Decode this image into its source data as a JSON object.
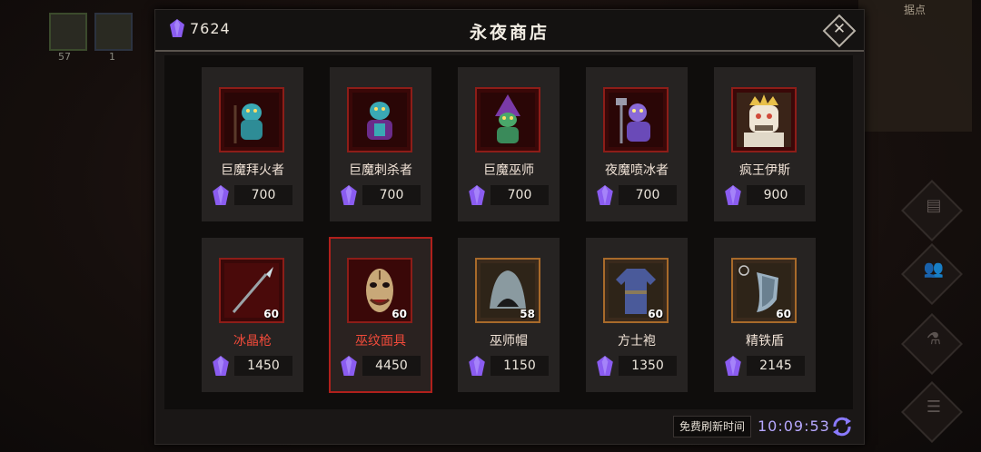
{
  "background": {
    "left_slots": [
      {
        "count": "57"
      },
      {
        "count": "1"
      }
    ],
    "minimap_title": "据点"
  },
  "shop": {
    "title": "永夜商店",
    "currency_total": "7624",
    "close_label": "✕",
    "refresh": {
      "label": "免费刷新时间",
      "time": "10:09:53"
    },
    "colors": {
      "gem": "#8a5cf0",
      "name_red": "#f04a3a",
      "selected_border": "#b0201c",
      "timer": "#b7a8ff"
    },
    "items": [
      {
        "name": "巨魔拜火者",
        "price": "700",
        "icon": "troll-fire-worshipper-icon",
        "level": ""
      },
      {
        "name": "巨魔刺杀者",
        "price": "700",
        "icon": "troll-assassin-icon",
        "level": ""
      },
      {
        "name": "巨魔巫师",
        "price": "700",
        "icon": "troll-wizard-icon",
        "level": ""
      },
      {
        "name": "夜魔喷冰者",
        "price": "700",
        "icon": "night-demon-ice-spitter-icon",
        "level": ""
      },
      {
        "name": "疯王伊斯",
        "price": "900",
        "icon": "mad-king-ice-icon",
        "level": ""
      },
      {
        "name": "冰晶枪",
        "price": "1450",
        "icon": "ice-crystal-spear-icon",
        "level": "60"
      },
      {
        "name": "巫纹面具",
        "price": "4450",
        "icon": "witch-rune-mask-icon",
        "level": "60"
      },
      {
        "name": "巫师帽",
        "price": "1150",
        "icon": "wizard-hat-icon",
        "level": "58"
      },
      {
        "name": "方士袍",
        "price": "1350",
        "icon": "alchemist-robe-icon",
        "level": "60"
      },
      {
        "name": "精铁盾",
        "price": "2145",
        "icon": "fine-iron-shield-icon",
        "level": "60"
      }
    ]
  }
}
